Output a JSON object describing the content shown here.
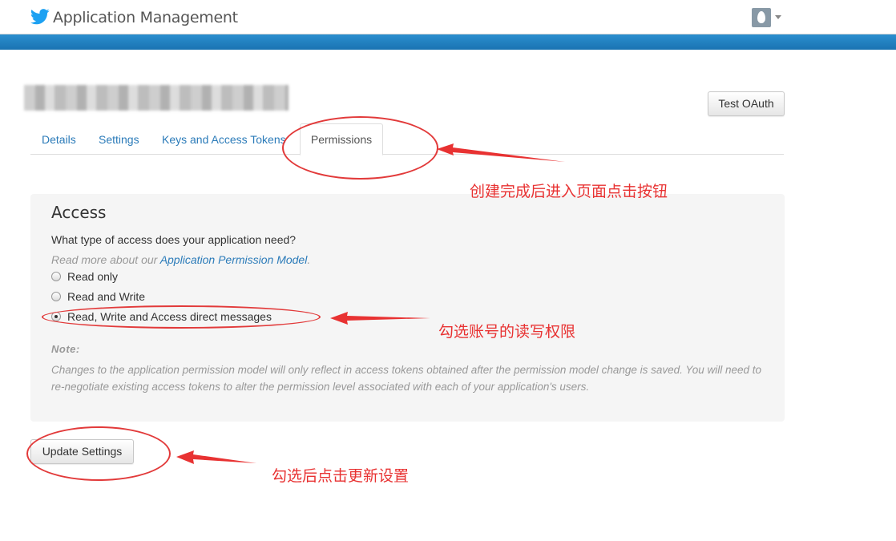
{
  "header": {
    "title": "Application Management",
    "brand_color": "#1da1f2",
    "band_color": "#1a7dc0"
  },
  "app": {
    "test_oauth_label": "Test OAuth"
  },
  "tabs": [
    {
      "label": "Details"
    },
    {
      "label": "Settings"
    },
    {
      "label": "Keys and Access Tokens"
    },
    {
      "label": "Permissions",
      "active": true
    }
  ],
  "access": {
    "title": "Access",
    "question": "What type of access does your application need?",
    "readmore_prefix": "Read more about our ",
    "readmore_link": "Application Permission Model",
    "readmore_suffix": ".",
    "options": [
      {
        "label": "Read only",
        "checked": false
      },
      {
        "label": "Read and Write",
        "checked": false
      },
      {
        "label": "Read, Write and Access direct messages",
        "checked": true
      }
    ],
    "note_label": "Note:",
    "note_text": "Changes to the application permission model will only reflect in access tokens obtained after the permission model change is saved. You will need to re-negotiate existing access tokens to alter the permission level associated with each of your application's users."
  },
  "actions": {
    "update_label": "Update Settings"
  },
  "annotations": {
    "color": "#e83232",
    "tab_note": "创建完成后进入页面点击按钮",
    "permission_note": "勾选账号的读写权限",
    "update_note": "勾选后点击更新设置"
  }
}
